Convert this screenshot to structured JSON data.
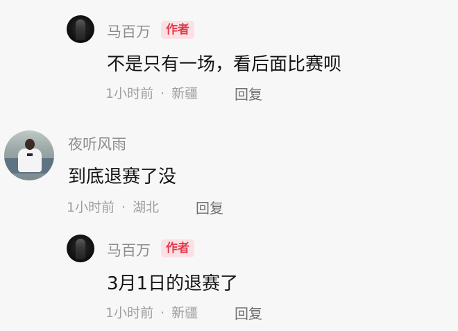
{
  "comments": [
    {
      "author": "马百万",
      "badge": "作者",
      "text": "不是只有一场，看后面比赛呗",
      "time": "1小时前",
      "location": "新疆",
      "reply": "回复"
    },
    {
      "author": "夜听风雨",
      "text": "到底退赛了没",
      "time": "1小时前",
      "location": "湖北",
      "reply": "回复"
    },
    {
      "author": "马百万",
      "badge": "作者",
      "text": "3月1日的退赛了",
      "time": "1小时前",
      "location": "新疆",
      "reply": "回复"
    }
  ],
  "icons": {
    "author_avatar": "author-avatar-icon",
    "user_avatar": "user-avatar-icon"
  },
  "colors": {
    "background": "#f7f7f7",
    "badge_text": "#e2384b",
    "badge_bg": "#fbe1e3",
    "meta_text": "#9e9e9e"
  }
}
